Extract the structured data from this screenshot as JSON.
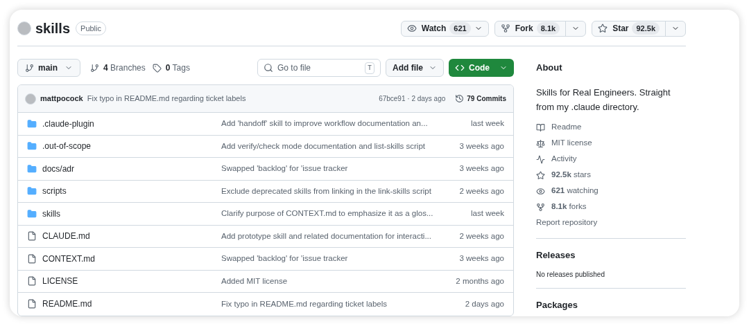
{
  "repo": {
    "name": "skills",
    "visibility": "Public"
  },
  "actions": [
    {
      "kind": "watch",
      "label": "Watch",
      "count": "621"
    },
    {
      "kind": "fork",
      "label": "Fork",
      "count": "8.1k"
    },
    {
      "kind": "star",
      "label": "Star",
      "count": "92.5k"
    }
  ],
  "branch": "main",
  "branches": {
    "count": "4",
    "label": "Branches"
  },
  "tags": {
    "count": "0",
    "label": "Tags"
  },
  "search": {
    "placeholder": "Go to file",
    "shortcut": "T"
  },
  "add_file": "Add file",
  "code_button": "Code",
  "commit": {
    "author": "mattpocock",
    "message": "Fix typo in README.md regarding ticket labels",
    "hash_time": "67bce91 · 2 days ago",
    "commits": "79 Commits"
  },
  "files": [
    {
      "kind": "folder",
      "name": ".claude-plugin",
      "message": "Add 'handoff' skill to improve workflow documentation an...",
      "time": "last week"
    },
    {
      "kind": "folder",
      "name": ".out-of-scope",
      "message": "Add verify/check mode documentation and list-skills script",
      "time": "3 weeks ago"
    },
    {
      "kind": "folder",
      "name": "docs/adr",
      "message": "Swapped 'backlog' for 'issue tracker",
      "time": "3 weeks ago"
    },
    {
      "kind": "folder",
      "name": "scripts",
      "message": "Exclude deprecated skills from linking in the link-skills script",
      "time": "2 weeks ago"
    },
    {
      "kind": "folder",
      "name": "skills",
      "message": "Clarify purpose of CONTEXT.md to emphasize it as a glos...",
      "time": "last week"
    },
    {
      "kind": "file",
      "name": "CLAUDE.md",
      "message": "Add prototype skill and related documentation for interacti...",
      "time": "2 weeks ago"
    },
    {
      "kind": "file",
      "name": "CONTEXT.md",
      "message": "Swapped 'backlog' for 'issue tracker",
      "time": "3 weeks ago"
    },
    {
      "kind": "file",
      "name": "LICENSE",
      "message": "Added MIT license",
      "time": "2 months ago"
    },
    {
      "kind": "file",
      "name": "README.md",
      "message": "Fix typo in README.md regarding ticket labels",
      "time": "2 days ago"
    }
  ],
  "about": {
    "title": "About",
    "description": "Skills for Real Engineers. Straight from my .claude directory.",
    "links": [
      {
        "kind": "book",
        "text": "Readme"
      },
      {
        "kind": "scale",
        "text": "MIT license"
      },
      {
        "kind": "pulse",
        "text": "Activity"
      },
      {
        "kind": "star",
        "text": "**92.5k** stars"
      },
      {
        "kind": "eye",
        "text": "**621** watching"
      },
      {
        "kind": "fork",
        "text": "**8.1k** forks"
      },
      {
        "kind": "none",
        "text": "Report repository"
      }
    ]
  },
  "releases": {
    "title": "Releases",
    "text": "No releases published"
  },
  "packages": {
    "title": "Packages"
  }
}
